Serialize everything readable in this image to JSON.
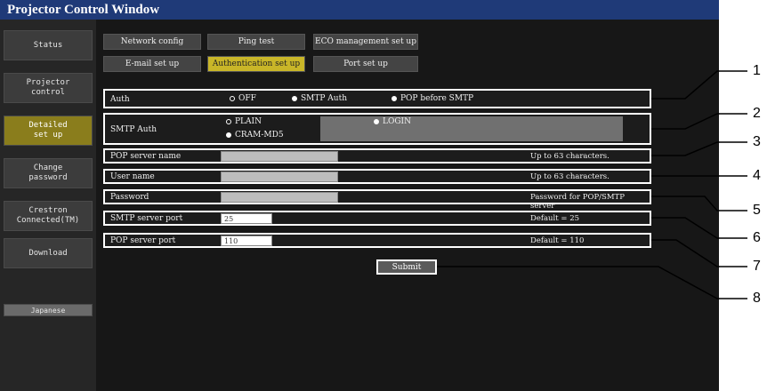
{
  "window": {
    "title": "Projector Control Window"
  },
  "sidebar": {
    "items": [
      {
        "label": "Status"
      },
      {
        "label": "Projector\ncontrol"
      },
      {
        "label": "Detailed\nset up",
        "active": true
      },
      {
        "label": "Change\npassword"
      },
      {
        "label": "Crestron\nConnected(TM)"
      },
      {
        "label": "Download"
      }
    ],
    "language_button": "Japanese"
  },
  "tabs": {
    "row1": [
      "Network config",
      "Ping test",
      "ECO management set up"
    ],
    "row2": [
      "E-mail set up",
      "Authentication set up",
      "Port set up"
    ],
    "active": "Authentication set up"
  },
  "auth": {
    "label": "Auth",
    "options": [
      "OFF",
      "SMTP Auth",
      "POP before SMTP"
    ],
    "selected": "OFF"
  },
  "smtp_auth": {
    "label": "SMTP Auth",
    "options": [
      "PLAIN",
      "LOGIN",
      "CRAM-MD5"
    ]
  },
  "pop_server_name": {
    "label": "POP server name",
    "hint": "Up to 63 characters.",
    "value": ""
  },
  "user_name": {
    "label": "User name",
    "hint": "Up to 63 characters.",
    "value": ""
  },
  "password": {
    "label": "Password",
    "hint": "Password for POP/SMTP server",
    "value": ""
  },
  "smtp_server_port": {
    "label": "SMTP server port",
    "value": "25",
    "hint": "Default = 25"
  },
  "pop_server_port": {
    "label": "POP server port",
    "value": "110",
    "hint": "Default = 110"
  },
  "submit_label": "Submit",
  "callouts": [
    "1",
    "2",
    "3",
    "4",
    "5",
    "6",
    "7",
    "8"
  ],
  "colors": {
    "title_bar": "#1f3a78",
    "active_tab": "#c9b628",
    "active_side": "#8a7d1c"
  }
}
